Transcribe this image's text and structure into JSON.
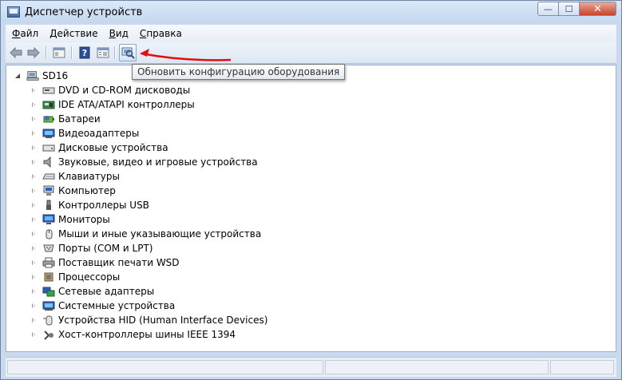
{
  "window": {
    "title": "Диспетчер устройств",
    "controls": {
      "minimize": "—",
      "maximize": "☐",
      "close": "✕"
    }
  },
  "menu": [
    {
      "label": "Файл",
      "accel": "Ф",
      "rest": "айл"
    },
    {
      "label": "Действие",
      "accel": "Д",
      "rest": "ействие"
    },
    {
      "label": "Вид",
      "accel": "В",
      "rest": "ид"
    },
    {
      "label": "Справка",
      "accel": "С",
      "rest": "правка"
    }
  ],
  "toolbar": {
    "buttons": [
      "back-icon",
      "forward-icon",
      "console-tree-icon",
      "help-icon",
      "properties-icon",
      "scan-hardware-icon"
    ],
    "tooltip": "Обновить конфигурацию оборудования"
  },
  "tree": {
    "root": "SD16",
    "items": [
      {
        "label": "DVD и CD-ROM дисководы",
        "icon": "optical-drive-icon"
      },
      {
        "label": "IDE ATA/ATAPI контроллеры",
        "icon": "ide-controller-icon"
      },
      {
        "label": "Батареи",
        "icon": "battery-icon"
      },
      {
        "label": "Видеоадаптеры",
        "icon": "display-adapter-icon"
      },
      {
        "label": "Дисковые устройства",
        "icon": "disk-drive-icon"
      },
      {
        "label": "Звуковые, видео и игровые устройства",
        "icon": "sound-icon"
      },
      {
        "label": "Клавиатуры",
        "icon": "keyboard-icon"
      },
      {
        "label": "Компьютер",
        "icon": "computer-icon"
      },
      {
        "label": "Контроллеры USB",
        "icon": "usb-icon"
      },
      {
        "label": "Мониторы",
        "icon": "monitor-icon"
      },
      {
        "label": "Мыши и иные указывающие устройства",
        "icon": "mouse-icon"
      },
      {
        "label": "Порты (COM и LPT)",
        "icon": "port-icon"
      },
      {
        "label": "Поставщик печати WSD",
        "icon": "printer-icon"
      },
      {
        "label": "Процессоры",
        "icon": "processor-icon"
      },
      {
        "label": "Сетевые адаптеры",
        "icon": "network-adapter-icon"
      },
      {
        "label": "Системные устройства",
        "icon": "system-device-icon"
      },
      {
        "label": "Устройства HID (Human Interface Devices)",
        "icon": "hid-icon"
      },
      {
        "label": "Хост-контроллеры шины IEEE 1394",
        "icon": "ieee1394-icon"
      }
    ]
  },
  "colors": {
    "annotation_arrow": "#e01010",
    "window_frame": "#c9d9ee"
  }
}
